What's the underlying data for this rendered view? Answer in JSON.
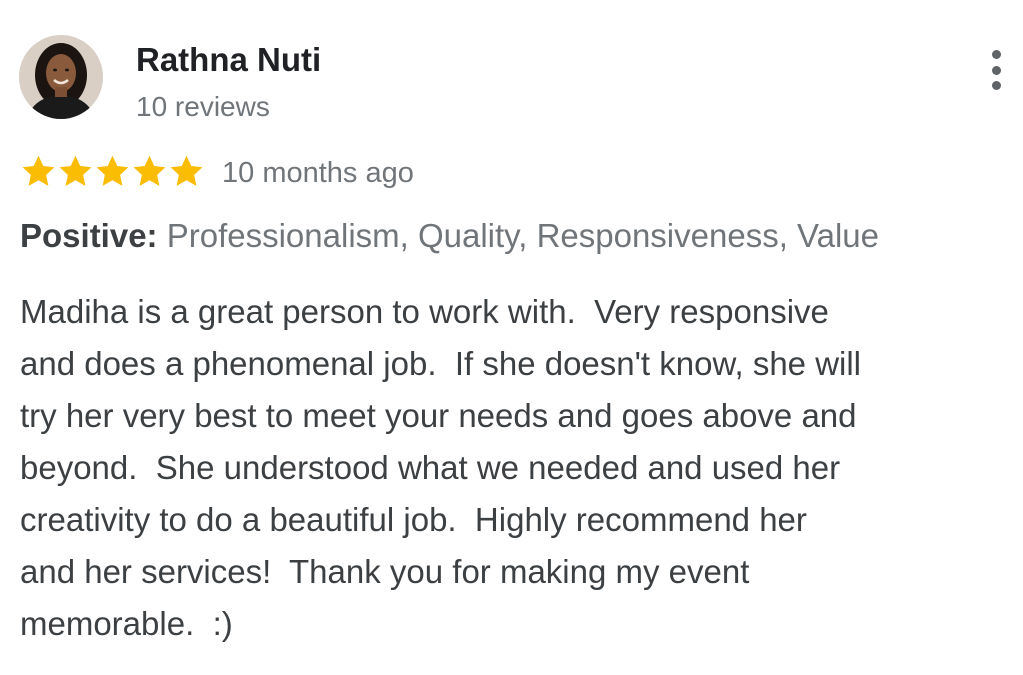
{
  "reviewer": {
    "name": "Rathna Nuti",
    "review_count": "10 reviews",
    "avatar_icon": "person-photo"
  },
  "menu": {
    "icon": "more-vert-icon"
  },
  "rating": {
    "stars": 5,
    "max_stars": 5,
    "star_color": "#fbbc04",
    "date": "10 months ago"
  },
  "attributes": {
    "label": "Positive:",
    "values": "Professionalism, Quality, Responsiveness, Value"
  },
  "review": {
    "lines": [
      "Madiha is a great person to work with.  Very responsive",
      "and does a phenomenal job.  If she doesn't know, she will",
      "try her very best to meet your needs and goes above and",
      "beyond.  She understood what we needed and used her",
      "creativity to do a beautiful job.  Highly recommend her",
      "and her services!  Thank you for making my event",
      "memorable.  :)"
    ]
  }
}
